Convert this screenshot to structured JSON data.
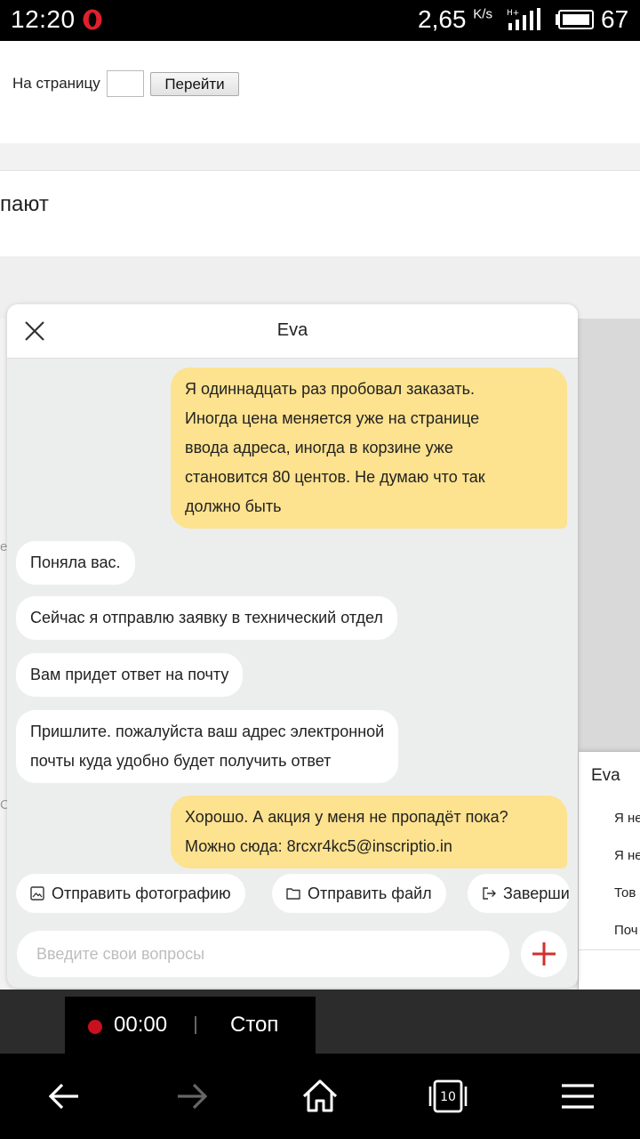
{
  "status_bar": {
    "time": "12:20",
    "speed": "2,65",
    "speed_unit": "K/s",
    "battery": "67",
    "icons": [
      "opera-icon",
      "signal-icon",
      "battery-icon"
    ]
  },
  "page": {
    "to_page_label": "На страницу",
    "go_button": "Перейти",
    "card_text": "пают",
    "fragment_left_1": "е",
    "fragment_left_2": "С"
  },
  "chat": {
    "title": "Eva",
    "messages": [
      {
        "from": "user",
        "lines": [
          "Я одиннадцать раз пробовал заказать.",
          "Иногда цена меняется уже на странице",
          "ввода адреса, иногда в корзине уже",
          "становится 80 центов. Не думаю что так",
          "должно быть"
        ]
      },
      {
        "from": "agent",
        "lines": [
          "Поняла вас."
        ]
      },
      {
        "from": "agent",
        "lines": [
          "Сейчас я отправлю заявку в технический отдел"
        ]
      },
      {
        "from": "agent",
        "lines": [
          "Вам придет ответ на почту"
        ]
      },
      {
        "from": "agent",
        "lines": [
          "Пришлите. пожалуйста ваш адрес электронной",
          "почты куда удобно будет получить ответ"
        ]
      },
      {
        "from": "user",
        "lines": [
          "Хорошо. А акция у меня не пропадёт пока?",
          "Можно сюда: 8rcxr4kc5@inscriptio.in"
        ]
      }
    ],
    "actions": {
      "send_photo": "Отправить фотографию",
      "send_file": "Отправить файл",
      "finish": "Заверши"
    },
    "input_placeholder": "Введите свои вопросы"
  },
  "popup2": {
    "title": "Eva",
    "lines": [
      "Я не",
      "Я не",
      "Тов",
      "Поч"
    ]
  },
  "recording": {
    "time": "00:00",
    "stop_label": "Стоп"
  },
  "colors": {
    "user_bubble": "#fde28f",
    "agent_bubble": "#ffffff",
    "chat_bg": "#eceeed",
    "accent_red": "#d32f2f",
    "record_dot": "#c8101e"
  }
}
